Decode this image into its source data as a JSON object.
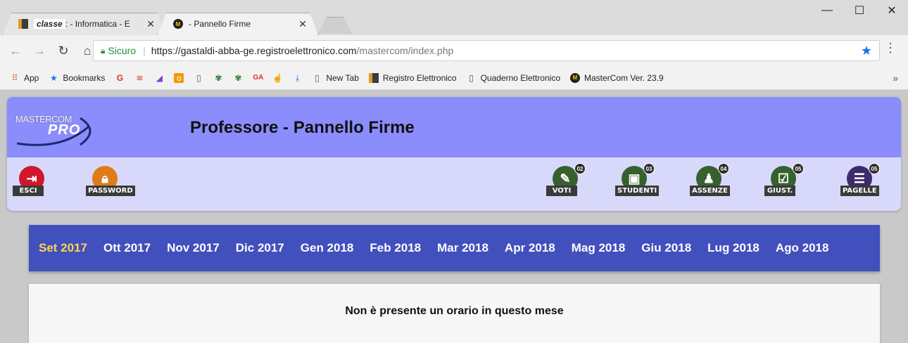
{
  "browser": {
    "tabs": [
      {
        "title_italic": "classe",
        "title": ": - Informatica - E"
      },
      {
        "title": "- Pannello Firme"
      }
    ],
    "window_controls": {
      "minimize": "—",
      "maximize": "☐",
      "close": "✕"
    },
    "address": {
      "secure_label": "Sicuro",
      "url_host": "https://gastaldi-abba-ge.registroelettronico.com",
      "url_path": "/mastercom/index.php"
    },
    "bookmarks": [
      {
        "label": "App",
        "icon": "apps-grid-icon"
      },
      {
        "label": "Bookmarks",
        "icon": "star-icon"
      },
      {
        "label": "",
        "icon": "google-icon"
      },
      {
        "label": "",
        "icon": "flag-icon"
      },
      {
        "label": "",
        "icon": "colored-icon"
      },
      {
        "label": "",
        "icon": "orange-square-icon"
      },
      {
        "label": "",
        "icon": "page-icon"
      },
      {
        "label": "",
        "icon": "green-icon"
      },
      {
        "label": "",
        "icon": "green-icon-2"
      },
      {
        "label": "",
        "icon": "ga-icon"
      },
      {
        "label": "",
        "icon": "hand-icon"
      },
      {
        "label": "",
        "icon": "download-icon"
      },
      {
        "label": "New Tab",
        "icon": "page-icon"
      },
      {
        "label": "Registro Elettronico",
        "icon": "registro-icon"
      },
      {
        "label": "Quaderno Elettronico",
        "icon": "page-icon"
      },
      {
        "label": "MasterCom Ver. 23.9",
        "icon": "mastercom-icon"
      }
    ],
    "overflow": "»"
  },
  "app": {
    "logo_text": "MASTERCOM",
    "logo_pro": "PRO",
    "title": "Professore - Pannello Firme",
    "tools_left": [
      {
        "label": "ESCI",
        "icon": "exit-icon"
      },
      {
        "label": "PASSWORD",
        "icon": "lock-icon"
      }
    ],
    "tools_right": [
      {
        "label": "VOTI",
        "badge": "02",
        "icon": "pencil-icon"
      },
      {
        "label": "STUDENTI",
        "badge": "03",
        "icon": "id-card-icon"
      },
      {
        "label": "ASSENZE",
        "badge": "04",
        "icon": "desk-icon"
      },
      {
        "label": "GIUST.",
        "badge": "05",
        "icon": "checklist-icon"
      },
      {
        "label": "PAGELLE",
        "badge": "05",
        "icon": "report-icon"
      }
    ],
    "months": [
      "Set 2017",
      "Ott 2017",
      "Nov 2017",
      "Dic 2017",
      "Gen 2018",
      "Feb 2018",
      "Mar 2018",
      "Apr 2018",
      "Mag 2018",
      "Giu 2018",
      "Lug 2018",
      "Ago 2018"
    ],
    "active_month": "Set 2017",
    "empty_message": "Non è presente un orario in questo mese"
  },
  "colors": {
    "header_top": "#8a8dfb",
    "header_bottom": "#d8d8fb",
    "month_bar": "#4150bd",
    "active_month": "#ffd54f"
  }
}
